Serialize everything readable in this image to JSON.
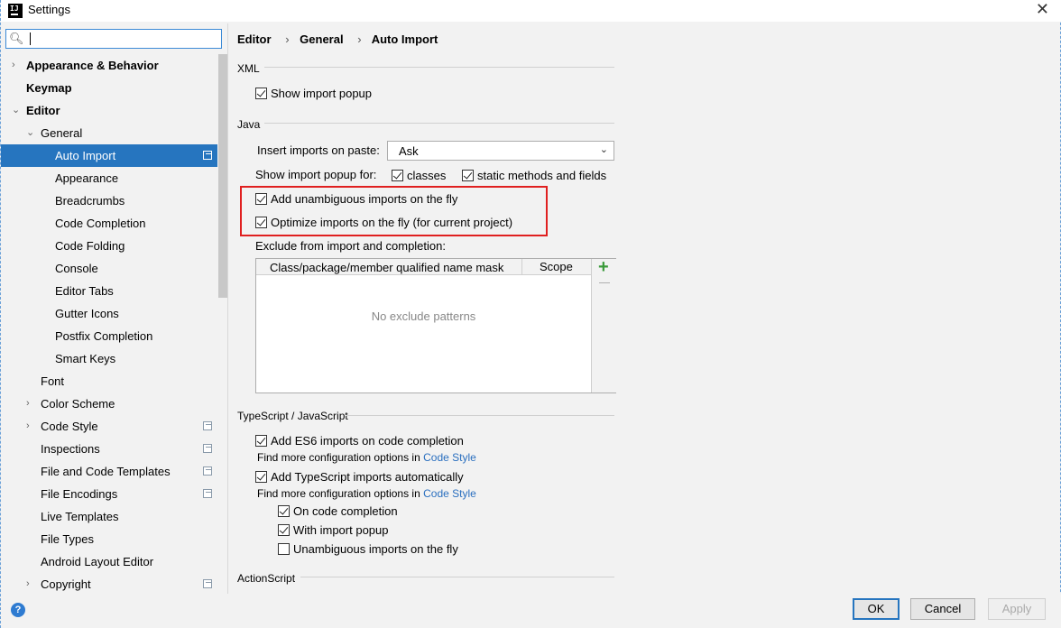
{
  "window": {
    "title": "Settings",
    "app_icon_text": "IJ"
  },
  "search": {
    "value": ""
  },
  "tree": [
    {
      "label": "Appearance & Behavior",
      "arrow": "›",
      "bold": true,
      "indent": 0
    },
    {
      "label": "Keymap",
      "arrow": "",
      "bold": true,
      "indent": 0
    },
    {
      "label": "Editor",
      "arrow": "⌄",
      "bold": true,
      "indent": 0
    },
    {
      "label": "General",
      "arrow": "⌄",
      "bold": false,
      "indent": 1
    },
    {
      "label": "Auto Import",
      "arrow": "",
      "bold": false,
      "indent": 2,
      "selected": true,
      "cfg": true
    },
    {
      "label": "Appearance",
      "arrow": "",
      "bold": false,
      "indent": 2
    },
    {
      "label": "Breadcrumbs",
      "arrow": "",
      "bold": false,
      "indent": 2
    },
    {
      "label": "Code Completion",
      "arrow": "",
      "bold": false,
      "indent": 2
    },
    {
      "label": "Code Folding",
      "arrow": "",
      "bold": false,
      "indent": 2
    },
    {
      "label": "Console",
      "arrow": "",
      "bold": false,
      "indent": 2
    },
    {
      "label": "Editor Tabs",
      "arrow": "",
      "bold": false,
      "indent": 2
    },
    {
      "label": "Gutter Icons",
      "arrow": "",
      "bold": false,
      "indent": 2
    },
    {
      "label": "Postfix Completion",
      "arrow": "",
      "bold": false,
      "indent": 2
    },
    {
      "label": "Smart Keys",
      "arrow": "",
      "bold": false,
      "indent": 2
    },
    {
      "label": "Font",
      "arrow": "",
      "bold": false,
      "indent": 1
    },
    {
      "label": "Color Scheme",
      "arrow": "›",
      "bold": false,
      "indent": 1
    },
    {
      "label": "Code Style",
      "arrow": "›",
      "bold": false,
      "indent": 1,
      "cfg": true
    },
    {
      "label": "Inspections",
      "arrow": "",
      "bold": false,
      "indent": 1,
      "cfg": true
    },
    {
      "label": "File and Code Templates",
      "arrow": "",
      "bold": false,
      "indent": 1,
      "cfg": true
    },
    {
      "label": "File Encodings",
      "arrow": "",
      "bold": false,
      "indent": 1,
      "cfg": true
    },
    {
      "label": "Live Templates",
      "arrow": "",
      "bold": false,
      "indent": 1
    },
    {
      "label": "File Types",
      "arrow": "",
      "bold": false,
      "indent": 1
    },
    {
      "label": "Android Layout Editor",
      "arrow": "",
      "bold": false,
      "indent": 1
    },
    {
      "label": "Copyright",
      "arrow": "›",
      "bold": false,
      "indent": 1,
      "cfg": true
    }
  ],
  "breadcrumb": {
    "a": "Editor",
    "b": "General",
    "c": "Auto Import",
    "sep": "›"
  },
  "xml": {
    "section": "XML",
    "show_popup": {
      "label": "Show import popup",
      "checked": true
    }
  },
  "java": {
    "section": "Java",
    "insert_label": "Insert imports on paste:",
    "insert_value": "Ask",
    "popup_for_label": "Show import popup for:",
    "classes": {
      "label": "classes",
      "checked": true
    },
    "static": {
      "label": "static methods and fields",
      "checked": true
    },
    "unambiguous": {
      "label": "Add unambiguous imports on the fly",
      "checked": true
    },
    "optimize": {
      "label": "Optimize imports on the fly (for current project)",
      "checked": true
    },
    "exclude_label": "Exclude from import and completion:",
    "table_col1": "Class/package/member qualified name mask",
    "table_col2": "Scope",
    "table_empty": "No exclude patterns"
  },
  "ts": {
    "section": "TypeScript / JavaScript",
    "es6": {
      "label": "Add ES6 imports on code completion",
      "checked": true
    },
    "find_more_1": "Find more configuration options in ",
    "code_style_link_1": "Code Style",
    "ts_auto": {
      "label": "Add TypeScript imports automatically",
      "checked": true
    },
    "find_more_2": "Find more configuration options in ",
    "code_style_link_2": "Code Style",
    "on_completion": {
      "label": "On code completion",
      "checked": true
    },
    "with_popup": {
      "label": "With import popup",
      "checked": true
    },
    "unamb": {
      "label": "Unambiguous imports on the fly",
      "checked": false
    }
  },
  "actionscript": {
    "section": "ActionScript"
  },
  "buttons": {
    "ok": "OK",
    "cancel": "Cancel",
    "apply": "Apply",
    "help": "?"
  }
}
